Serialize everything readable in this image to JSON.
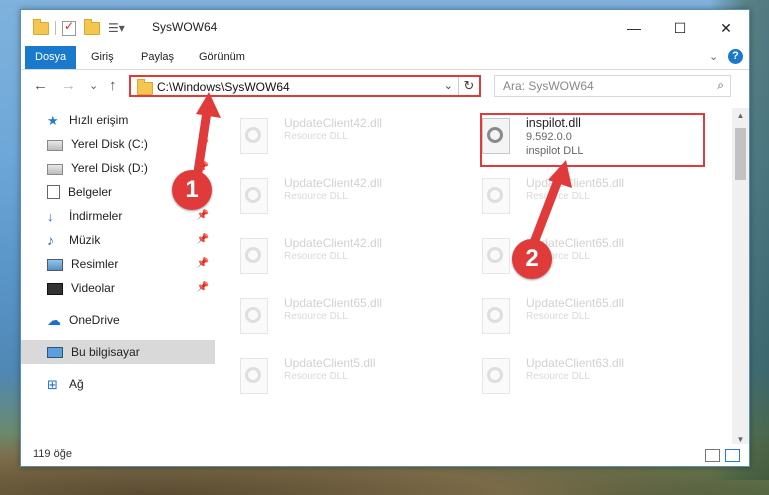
{
  "window": {
    "title": "SysWOW64",
    "controls": {
      "minimize": "—",
      "maximize": "☐",
      "close": "✕"
    }
  },
  "ribbon": {
    "tabs": [
      {
        "label": "Dosya",
        "active": true
      },
      {
        "label": "Giriş"
      },
      {
        "label": "Paylaş"
      },
      {
        "label": "Görünüm"
      }
    ],
    "expand": "⌄",
    "help": "?"
  },
  "navigation": {
    "back": "←",
    "forward": "→",
    "recent": "⌄",
    "up": "↑",
    "address": "C:\\Windows\\SysWOW64",
    "address_chevron": "⌄",
    "refresh": "↻",
    "search_placeholder": "Ara: SysWOW64",
    "search_icon": "⌕"
  },
  "sidebar": {
    "items": [
      {
        "label": "Hızlı erişim",
        "icon": "star-icon"
      },
      {
        "label": "Yerel Disk (C:)",
        "icon": "drive-icon",
        "pinned": true
      },
      {
        "label": "Yerel Disk (D:)",
        "icon": "drive-icon",
        "pinned": true
      },
      {
        "label": "Belgeler",
        "icon": "document-icon",
        "pinned": true
      },
      {
        "label": "İndirmeler",
        "icon": "download-icon",
        "pinned": true
      },
      {
        "label": "Müzik",
        "icon": "music-icon",
        "pinned": true
      },
      {
        "label": "Resimler",
        "icon": "pictures-icon",
        "pinned": true
      },
      {
        "label": "Videolar",
        "icon": "videos-icon",
        "pinned": true
      },
      {
        "label": "OneDrive",
        "icon": "onedrive-icon"
      },
      {
        "label": "Bu bilgisayar",
        "icon": "computer-icon",
        "selected": true
      },
      {
        "label": "Ağ",
        "icon": "network-icon"
      }
    ],
    "pin_glyph": "📌"
  },
  "files": [
    {
      "name": "UpdateClient42.dll",
      "type": "Resource DLL"
    },
    {
      "name": "inspilot.dll",
      "version": "9.592.0.0",
      "type": "inspilot DLL",
      "highlighted": true
    },
    {
      "name": "UpdateClient42.dll",
      "type": "Resource DLL"
    },
    {
      "name": "UpdateClient65.dll",
      "type": "Resource DLL"
    },
    {
      "name": "UpdateClient42.dll",
      "type": "Resource DLL"
    },
    {
      "name": "UpdateClient65.dll",
      "type": "Resource DLL"
    },
    {
      "name": "UpdateClient65.dll",
      "type": "Resource DLL"
    },
    {
      "name": "UpdateClient65.dll",
      "type": "Resource DLL"
    },
    {
      "name": "UpdateClient5.dll",
      "type": "Resource DLL"
    },
    {
      "name": "UpdateClient63.dll",
      "type": "Resource DLL"
    }
  ],
  "status": {
    "item_count": "119 öğe"
  },
  "annotations": {
    "step1": "1",
    "step2": "2",
    "color": "#e03a3a"
  }
}
